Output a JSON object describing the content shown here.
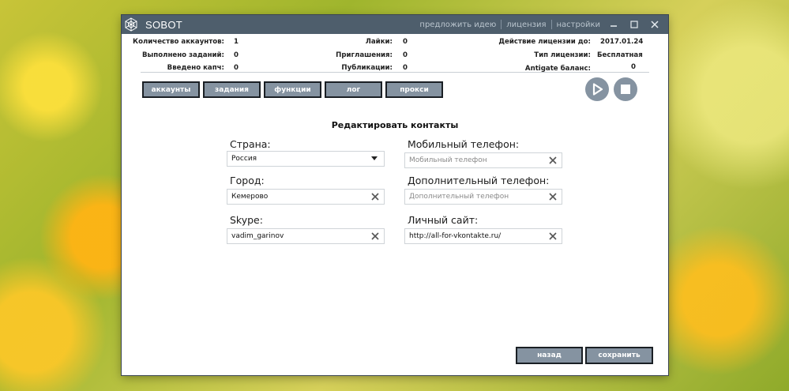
{
  "window": {
    "title": "SOBOT",
    "menu": [
      "предложить идею",
      "лицензия",
      "настройки"
    ]
  },
  "stats": {
    "accounts_label": "Количество аккаунтов:",
    "accounts_value": "1",
    "tasks_label": "Выполнено заданий:",
    "tasks_value": "0",
    "captcha_label": "Введено капч:",
    "captcha_value": "0",
    "likes_label": "Лайки:",
    "likes_value": "0",
    "invites_label": "Приглашения:",
    "invites_value": "0",
    "posts_label": "Публикации:",
    "posts_value": "0",
    "license_until_label": "Действие лицензии до:",
    "license_until_value": "2017.01.24",
    "license_type_label": "Тип лицензии:",
    "license_type_value": "Бесплатная",
    "antigate_label": "Antigate баланс:",
    "antigate_value": "0"
  },
  "tabs": [
    "аккаунты",
    "задания",
    "функции",
    "лог",
    "прокси"
  ],
  "section_title": "Редактировать контакты",
  "form": {
    "country_label": "Страна:",
    "country_value": "Россия",
    "city_label": "Город:",
    "city_value": "Кемерово",
    "skype_label": "Skype:",
    "skype_value": "vadim_garinov",
    "mobile_label": "Мобильный телефон:",
    "mobile_placeholder": "Мобильный телефон",
    "extra_phone_label": "Дополнительный телефон:",
    "extra_phone_placeholder": "Дополнительный телефон",
    "site_label": "Личный сайт:",
    "site_value": "http://all-for-vkontakte.ru/"
  },
  "buttons": {
    "back": "назад",
    "save": "сохранить"
  },
  "colors": {
    "titlebar": "#4e5e6c",
    "button": "#8593a1",
    "button_border": "#1a1f24"
  }
}
